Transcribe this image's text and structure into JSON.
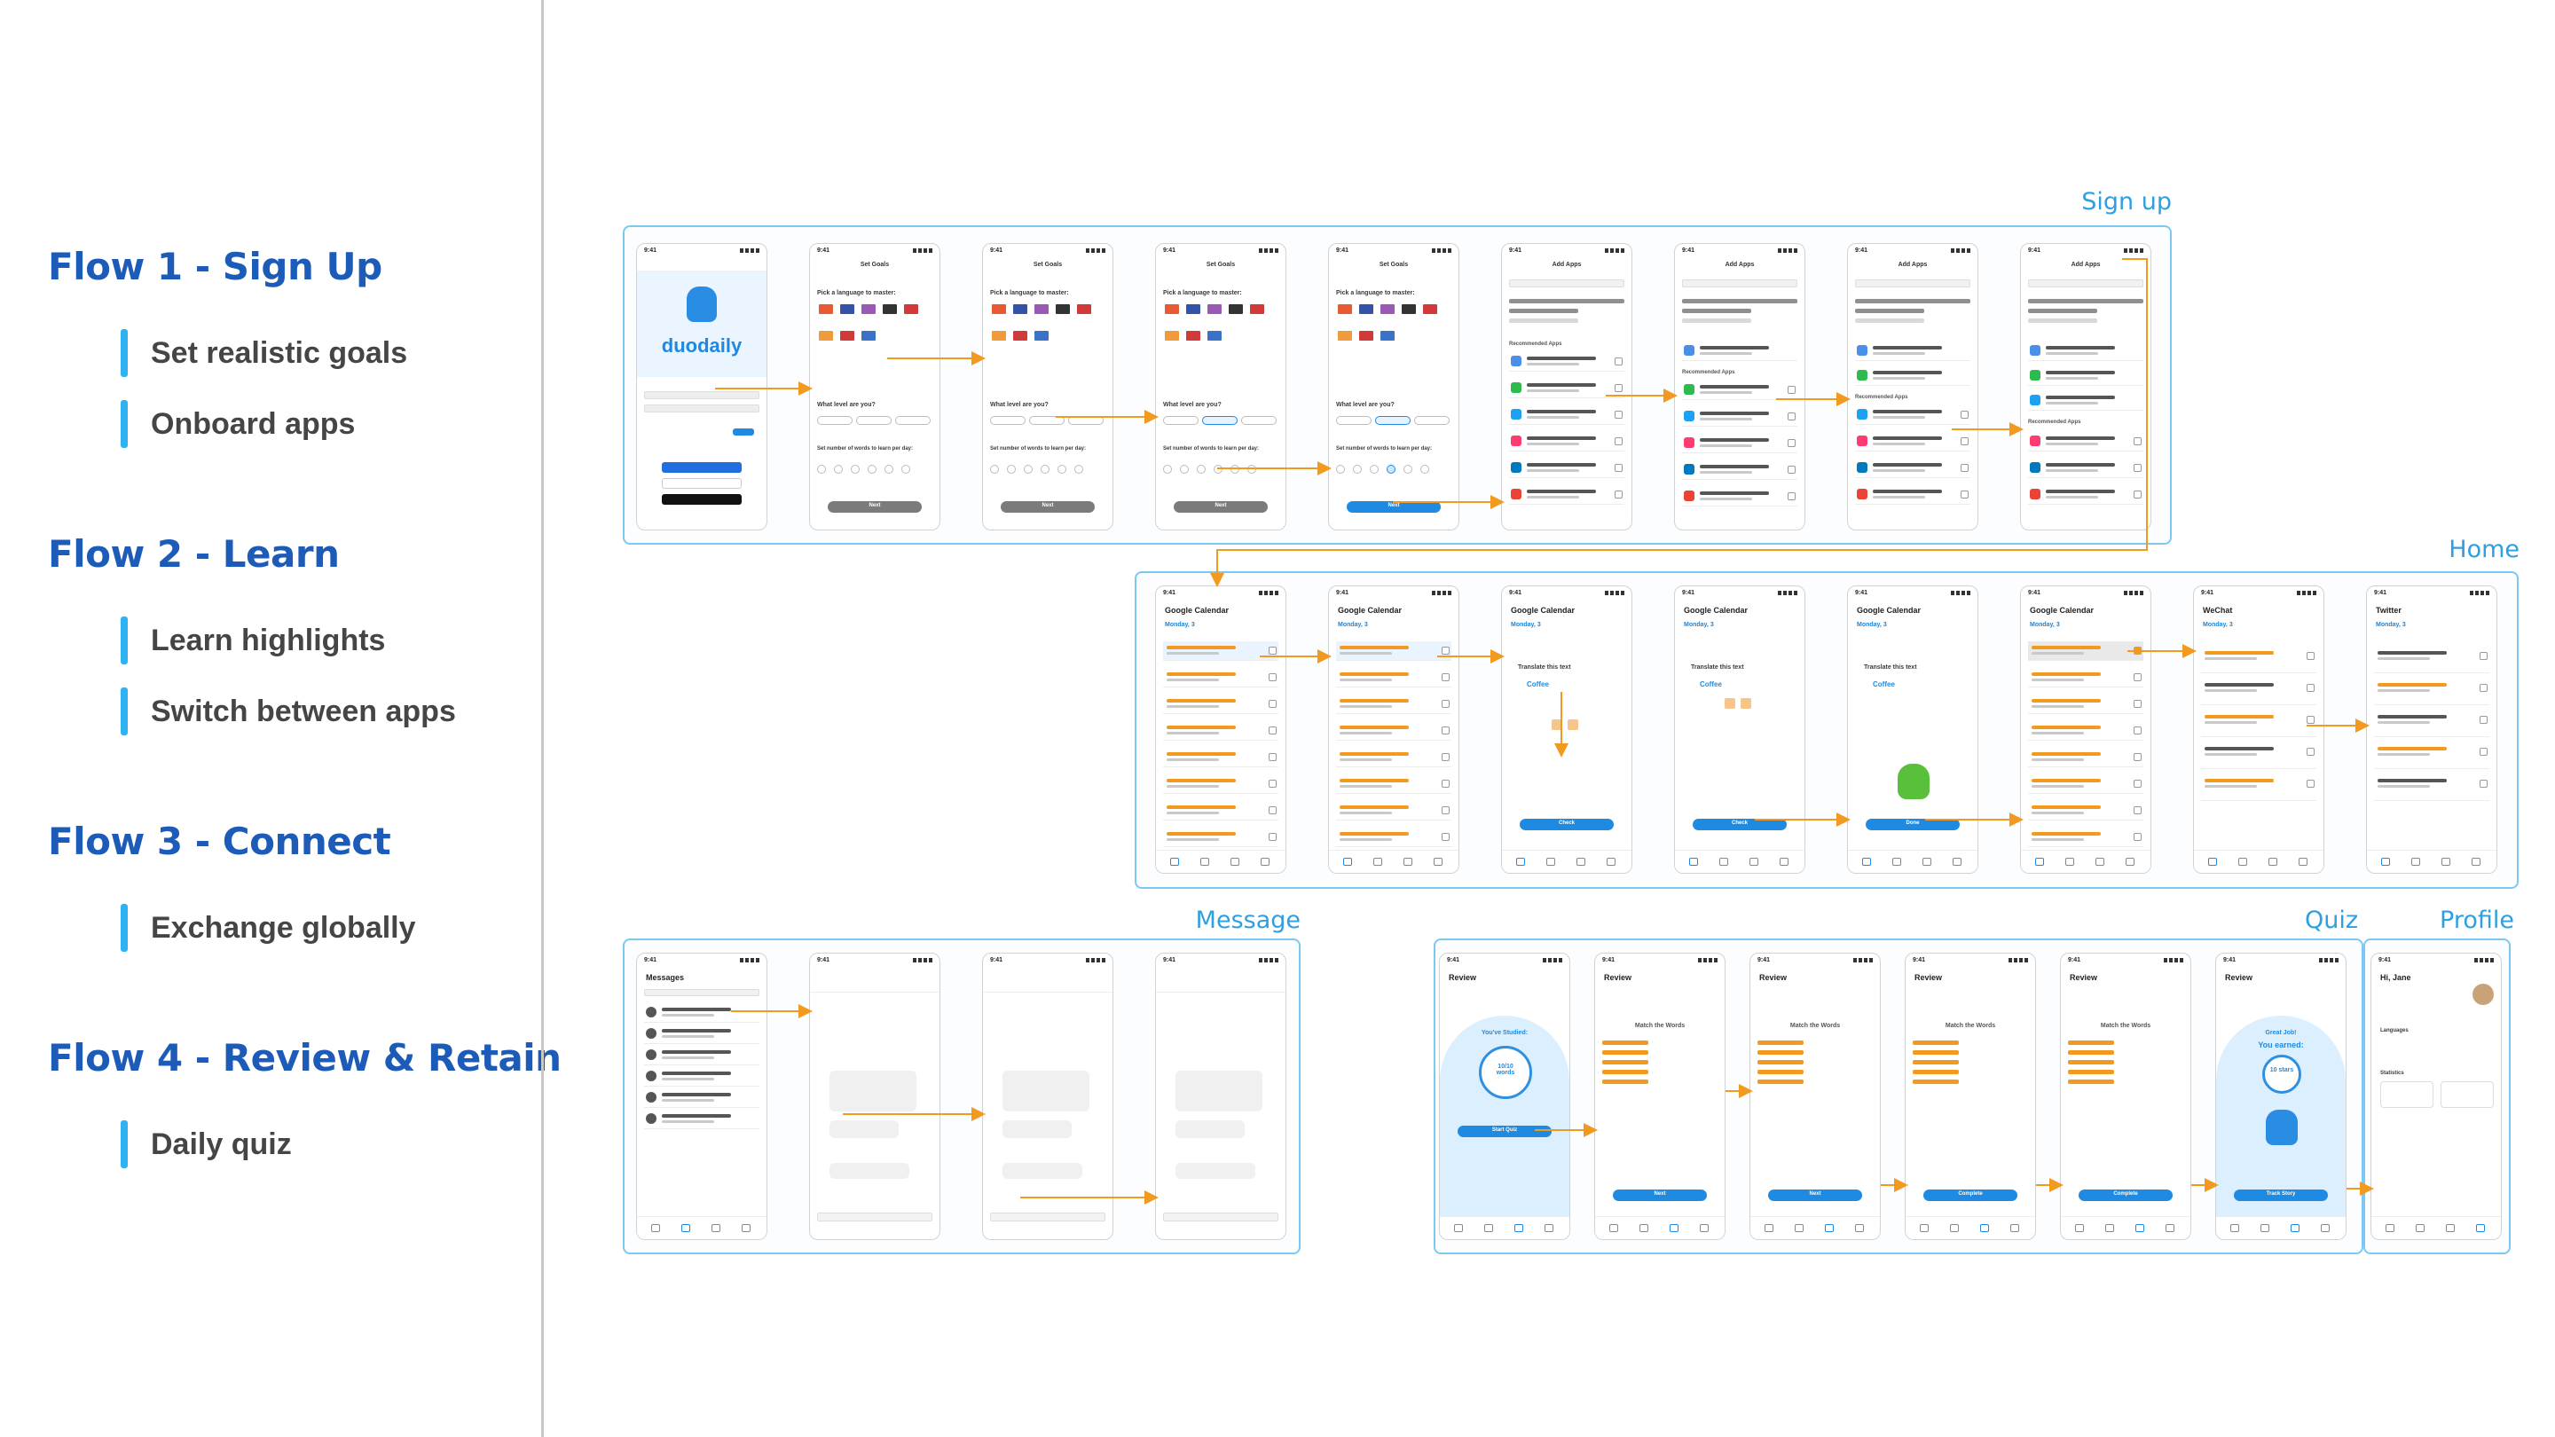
{
  "flows": [
    {
      "title": "Flow 1 - Sign Up",
      "items": [
        "Set realistic goals",
        "Onboard apps"
      ]
    },
    {
      "title": "Flow 2 - Learn",
      "items": [
        "Learn highlights",
        "Switch between apps"
      ]
    },
    {
      "title": "Flow 3 - Connect",
      "items": [
        "Exchange globally"
      ]
    },
    {
      "title": "Flow 4 - Review & Retain",
      "items": [
        "Daily quiz"
      ]
    }
  ],
  "sections": {
    "signup": "Sign up",
    "home": "Home",
    "message": "Message",
    "quiz": "Quiz",
    "profile": "Profile"
  },
  "screens": {
    "time": "9:41",
    "brand": "duodaily",
    "set_goals": "Set Goals",
    "pick_language": "Pick a language to master:",
    "what_level": "What level are you?",
    "words_per_day": "Set number of words to learn per day:",
    "next": "Next",
    "add_apps": "Add Apps",
    "recommended_apps": "Recommended Apps",
    "google_calendar": "Google Calendar",
    "wechat": "WeChat",
    "twitter": "Twitter",
    "monday": "Monday, 3",
    "translate": "Translate this text",
    "coffee": "Coffee",
    "check": "Check",
    "done": "Done",
    "messages": "Messages",
    "review": "Review",
    "you_studied": "You've Studied:",
    "words_count": "10/10 words",
    "start_quiz": "Start Quiz",
    "match_words": "Match the Words",
    "complete": "Complete",
    "great_job": "Great Job!",
    "you_earned": "You earned:",
    "stars": "10 stars",
    "track_story": "Track Story",
    "hi_jane": "Hi, Jane",
    "languages": "Languages",
    "statistics": "Statistics"
  },
  "colors": {
    "flow_title": "#1d5bb8",
    "accent_bar": "#2fb2f2",
    "section_border": "#7cc8f2",
    "section_label": "#2e9fe0",
    "connector": "#f29a1f",
    "button_blue": "#1f8ae2"
  }
}
